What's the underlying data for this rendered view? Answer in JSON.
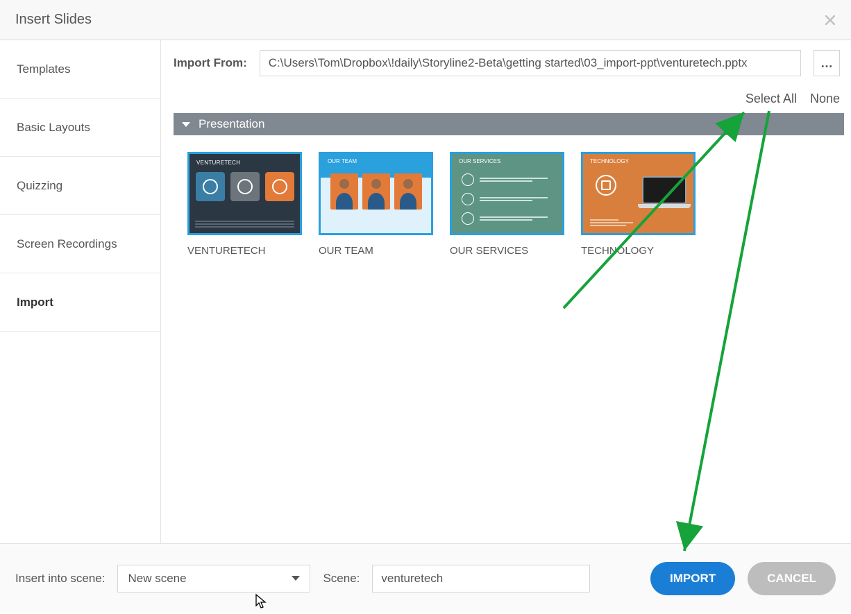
{
  "dialog": {
    "title": "Insert Slides"
  },
  "sidebar": {
    "items": [
      {
        "label": "Templates"
      },
      {
        "label": "Basic Layouts"
      },
      {
        "label": "Quizzing"
      },
      {
        "label": "Screen Recordings"
      },
      {
        "label": "Import"
      }
    ],
    "active_index": 4
  },
  "import_from": {
    "label": "Import From:",
    "path": "C:\\Users\\Tom\\Dropbox\\!daily\\Storyline2-Beta\\getting started\\03_import-ppt\\venturetech.pptx",
    "browse_label": "…"
  },
  "selection": {
    "select_all": "Select All",
    "none": "None"
  },
  "section": {
    "header": "Presentation"
  },
  "slides": [
    {
      "title": "VENTURETECH",
      "header": "VENTURETECH"
    },
    {
      "title": "OUR TEAM",
      "header": "OUR TEAM"
    },
    {
      "title": "OUR SERVICES",
      "header": "OUR SERVICES"
    },
    {
      "title": "TECHNOLOGY",
      "header": "TECHNOLOGY"
    }
  ],
  "footer": {
    "insert_into_label": "Insert into scene:",
    "scene_dropdown_value": "New scene",
    "scene_label": "Scene:",
    "scene_name_value": "venturetech",
    "import_btn": "IMPORT",
    "cancel_btn": "CANCEL"
  }
}
